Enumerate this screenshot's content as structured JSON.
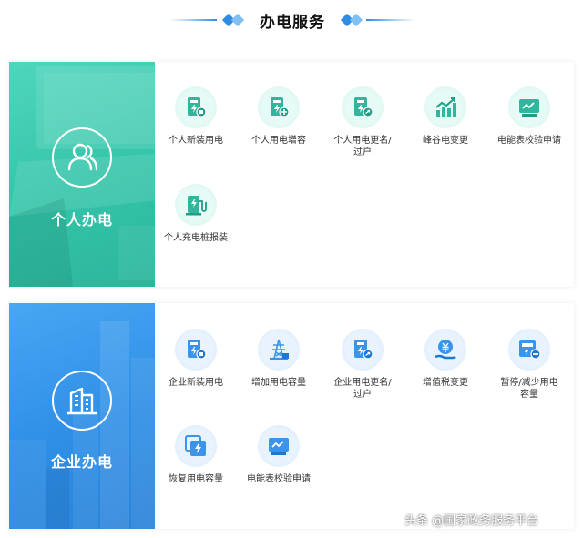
{
  "header": {
    "title": "办电服务"
  },
  "colors": {
    "personal": "#34c4a9",
    "enterprise": "#2f8fe6",
    "accent": "#2e8ce6"
  },
  "personal": {
    "label": "个人办电",
    "icon": "person-icon",
    "items": [
      {
        "label": "个人新装用电",
        "icon": "new-meter-icon"
      },
      {
        "label": "个人用电增容",
        "icon": "capacity-add-icon"
      },
      {
        "label": "个人用电更名/\n过户",
        "icon": "rename-transfer-icon"
      },
      {
        "label": "峰谷电变更",
        "icon": "peak-valley-chart-icon"
      },
      {
        "label": "电能表校验申请",
        "icon": "meter-check-icon"
      },
      {
        "label": "个人充电桩报装",
        "icon": "charging-pile-icon"
      }
    ]
  },
  "enterprise": {
    "label": "企业办电",
    "icon": "building-icon",
    "items": [
      {
        "label": "企业新装用电",
        "icon": "new-meter-icon"
      },
      {
        "label": "增加用电容量",
        "icon": "power-tower-icon"
      },
      {
        "label": "企业用电更名/\n过户",
        "icon": "rename-transfer-icon"
      },
      {
        "label": "增值税变更",
        "icon": "vat-change-icon"
      },
      {
        "label": "暂停/减少用电\n容量",
        "icon": "pause-reduce-icon"
      },
      {
        "label": "恢复用电容量",
        "icon": "restore-capacity-icon"
      },
      {
        "label": "电能表校验申请",
        "icon": "meter-check-icon"
      }
    ]
  },
  "watermark": "头条 @国家政务服务平台"
}
